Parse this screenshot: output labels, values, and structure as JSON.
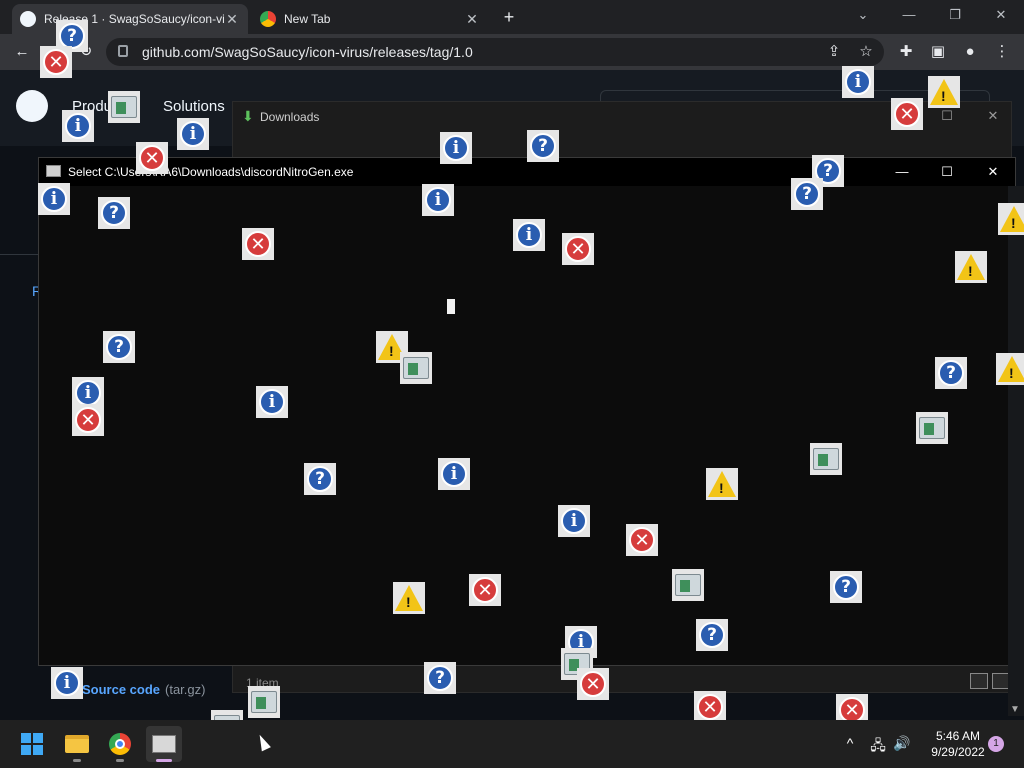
{
  "browser": {
    "tabs": [
      {
        "title": "Release 1 · SwagSoSaucy/icon-vi",
        "close": "✕",
        "active": true
      },
      {
        "title": "New Tab",
        "close": "✕",
        "active": false
      }
    ],
    "new_tab": "+",
    "window_controls": {
      "dropdown": "⌄",
      "minimize": "—",
      "restore": "❐",
      "close": "✕"
    },
    "nav": {
      "back": "←",
      "reload": "↻"
    },
    "url": "github.com/SwagSoSaucy/icon-virus/releases/tag/1.0",
    "toolbar_icons": {
      "share": "⇪",
      "bookmark": "☆",
      "extensions": "✚",
      "sidebar": "▣",
      "profile": "●",
      "menu": "⋮"
    }
  },
  "github": {
    "nav": [
      "Produ",
      "Solutions"
    ],
    "side_link": "R",
    "asset": {
      "name": "Source code",
      "ext": "(tar.gz)"
    }
  },
  "downloads_window": {
    "title": "Downloads",
    "status": "1 item",
    "controls": {
      "maximize": "☐",
      "close": "✕"
    }
  },
  "console_window": {
    "title": "Select C:\\Users\\RA6\\Downloads\\discordNitroGen.exe",
    "controls": {
      "minimize": "—",
      "maximize": "☐",
      "close": "✕"
    }
  },
  "popup_icons": {
    "info": "i",
    "question": "?",
    "error": "✕",
    "warning": "!"
  },
  "taskbar": {
    "tray_icons": {
      "chevron": "^",
      "network": "🖧",
      "volume": "🔊"
    },
    "time": "5:46 AM",
    "date": "9/29/2022",
    "notifications": "1"
  }
}
